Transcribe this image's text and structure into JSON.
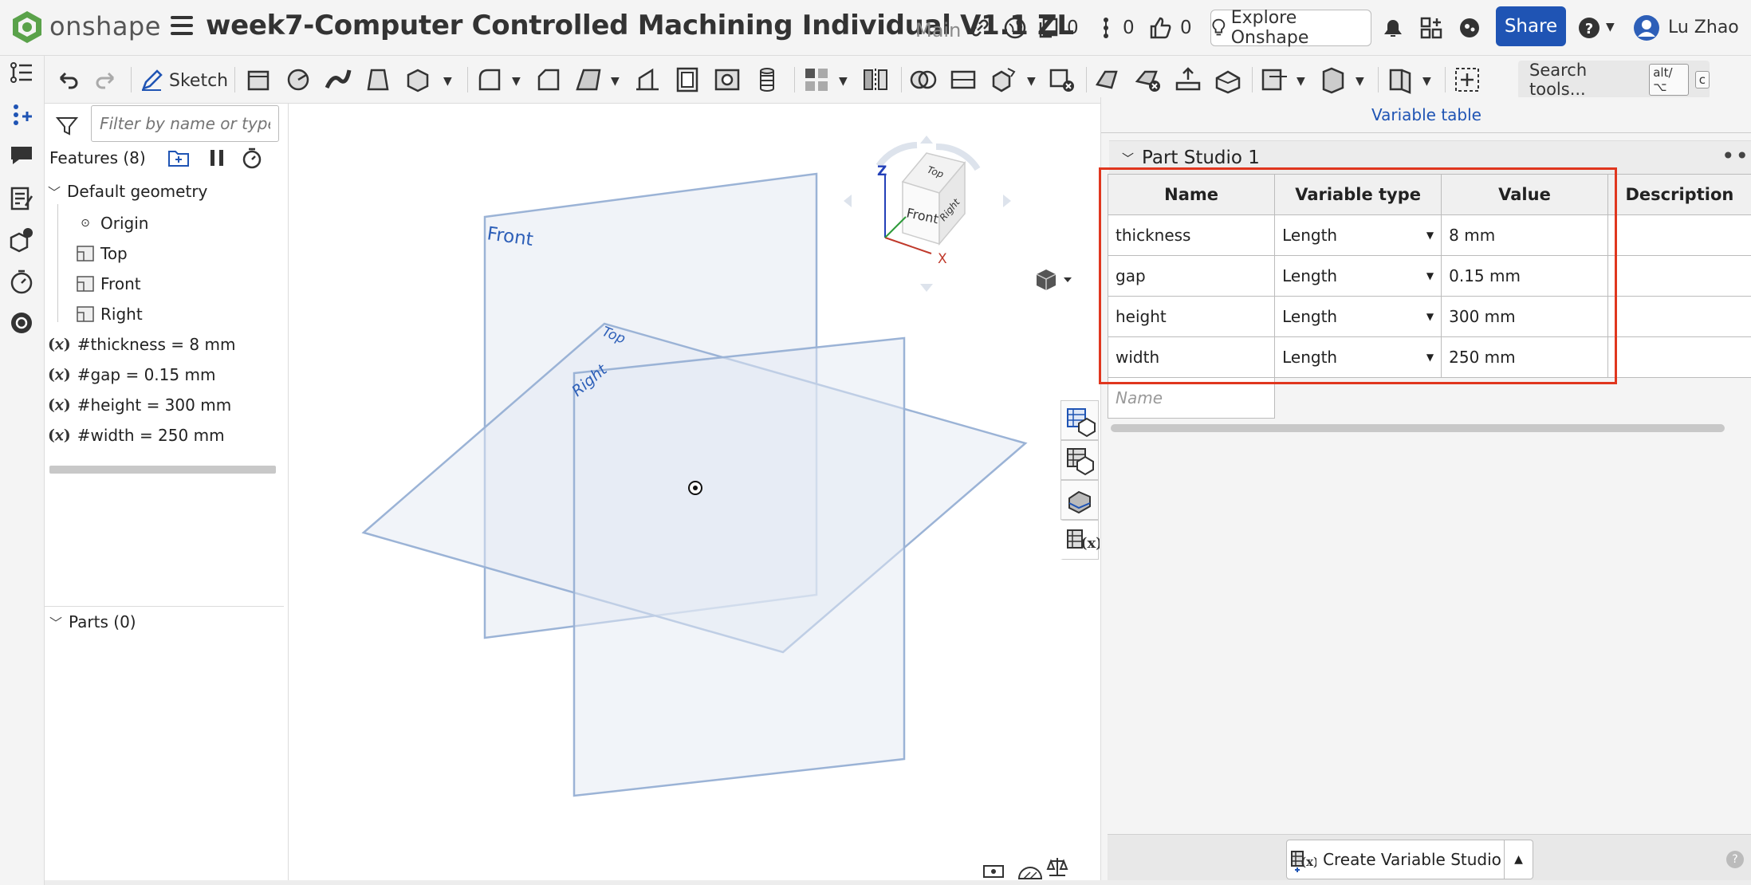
{
  "header": {
    "brand": "onshape",
    "doc_title": "week7-Computer Controlled Machining Individual V1.1 ZL",
    "branch": "Main",
    "versions_count": "0",
    "instances_count": "0",
    "likes_count": "0",
    "explore_label": "Explore Onshape",
    "share_label": "Share",
    "user_name": "Lu Zhao"
  },
  "toolbar": {
    "sketch_label": "Sketch",
    "search_label": "Search tools...",
    "search_key1": "alt/⌥",
    "search_key2": "c"
  },
  "feature_panel": {
    "filter_placeholder": "Filter by name or type",
    "features_header": "Features (8)",
    "default_geometry": "Default geometry",
    "origin": "Origin",
    "planes": [
      "Top",
      "Front",
      "Right"
    ],
    "variables": [
      "#thickness = 8 mm",
      "#gap = 0.15 mm",
      "#height = 300 mm",
      "#width = 250 mm"
    ],
    "parts_header": "Parts (0)"
  },
  "viewport": {
    "plane_labels": {
      "front": "Front",
      "top": "Top",
      "right": "Right"
    },
    "cube": {
      "top": "Top",
      "front": "Front",
      "right": "Right",
      "axis_x": "X",
      "axis_z": "Z"
    }
  },
  "variable_table": {
    "title": "Variable table",
    "studio_name": "Part Studio 1",
    "columns": [
      "Name",
      "Variable type",
      "Value",
      "Description"
    ],
    "rows": [
      {
        "name": "thickness",
        "type": "Length",
        "value": "8 mm"
      },
      {
        "name": "gap",
        "type": "Length",
        "value": "0.15 mm"
      },
      {
        "name": "height",
        "type": "Length",
        "value": "300 mm"
      },
      {
        "name": "width",
        "type": "Length",
        "value": "250 mm"
      }
    ],
    "name_placeholder": "Name",
    "create_label": "Create Variable Studio"
  },
  "colors": {
    "accent": "#1f54b4",
    "highlight": "#e0361e",
    "plane": "#9bb3d6"
  }
}
